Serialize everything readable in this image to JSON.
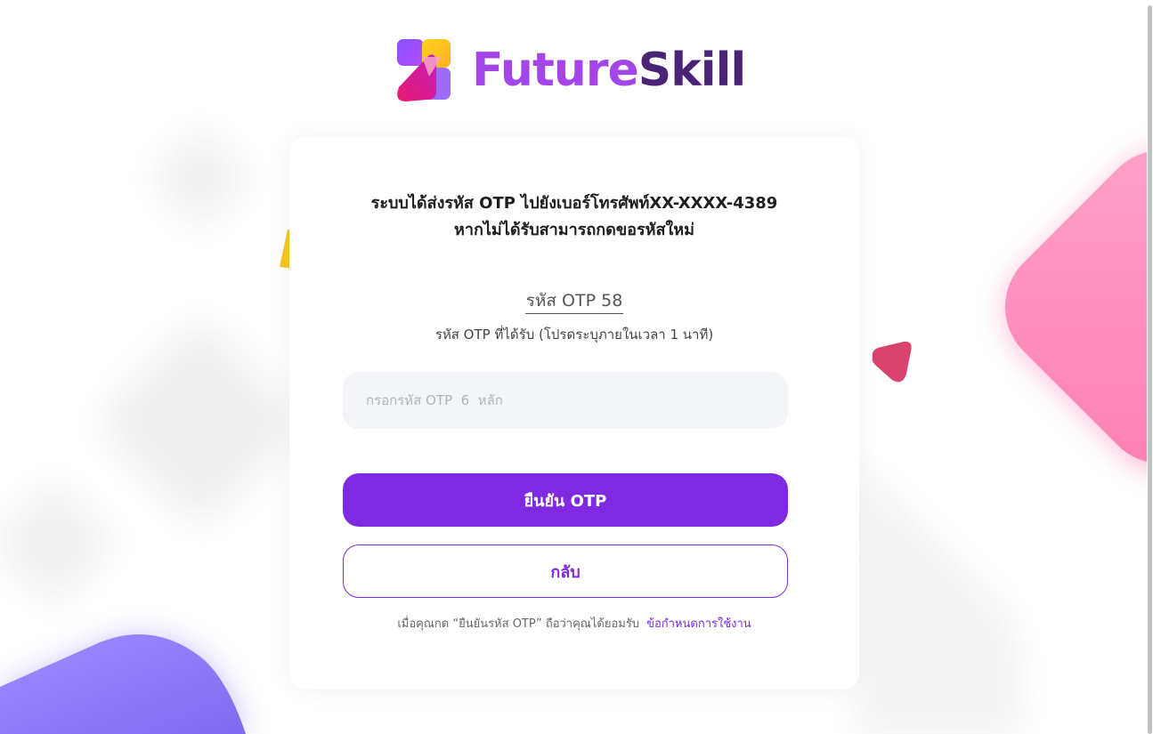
{
  "brand": {
    "name_part1": "Future",
    "name_part2": "Skill",
    "logo_icon": "futureskill-logo-icon",
    "colors": {
      "primary": "#7f2ae0",
      "brand_light": "#a445e8",
      "brand_dark": "#4a2276"
    }
  },
  "otp_page": {
    "message_line1": "ระบบได้ส่งรหัส OTP ไปยังเบอร์โทรศัพท์XX-XXXX-4389",
    "message_line2": "หากไม่ได้รับสามารถกดขอรหัสใหม่",
    "otp_reference": "รหัส OTP 58",
    "otp_hint": "รหัส OTP ที่ได้รับ (โปรดระบุภายในเวลา 1 นาที)",
    "input": {
      "value": "",
      "placeholder": "กรอกรหัส OTP  6  หลัก"
    },
    "confirm_button": "ยืนยัน OTP",
    "back_button": "กลับ",
    "terms_text": "เมื่อคุณกด “ยืนยันรหัส OTP” ถือว่าคุณได้ยอมรับ",
    "terms_link": "ข้อกำหนดการใช้งาน"
  }
}
